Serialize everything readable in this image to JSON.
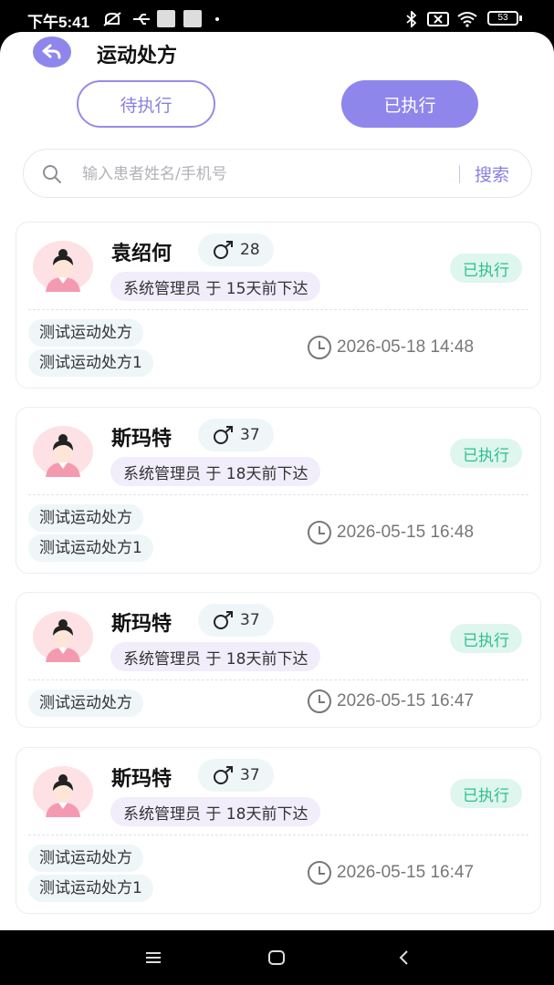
{
  "status_bar": {
    "time": "下午5:41",
    "battery": "53"
  },
  "header": {
    "title": "运动处方"
  },
  "tabs": [
    {
      "label": "待执行"
    },
    {
      "label": "已执行"
    }
  ],
  "search": {
    "placeholder": "输入患者姓名/手机号",
    "button": "搜索"
  },
  "records": [
    {
      "name": "袁绍何",
      "age": "28",
      "issued": "系统管理员 于 15天前下达",
      "status": "已执行",
      "tags": [
        "测试运动处方",
        "测试运动处方1"
      ],
      "time": "2026-05-18 14:48"
    },
    {
      "name": "斯玛特",
      "age": "37",
      "issued": "系统管理员 于 18天前下达",
      "status": "已执行",
      "tags": [
        "测试运动处方",
        "测试运动处方1"
      ],
      "time": "2026-05-15 16:48"
    },
    {
      "name": "斯玛特",
      "age": "37",
      "issued": "系统管理员 于 18天前下达",
      "status": "已执行",
      "tags": [
        "测试运动处方"
      ],
      "time": "2026-05-15 16:47"
    },
    {
      "name": "斯玛特",
      "age": "37",
      "issued": "系统管理员 于 18天前下达",
      "status": "已执行",
      "tags": [
        "测试运动处方",
        "测试运动处方1"
      ],
      "time": "2026-05-15 16:47"
    }
  ],
  "colors": {
    "accent": "#8f86ec",
    "status_green": "#2fbf8c",
    "status_bg": "#def6ee"
  }
}
